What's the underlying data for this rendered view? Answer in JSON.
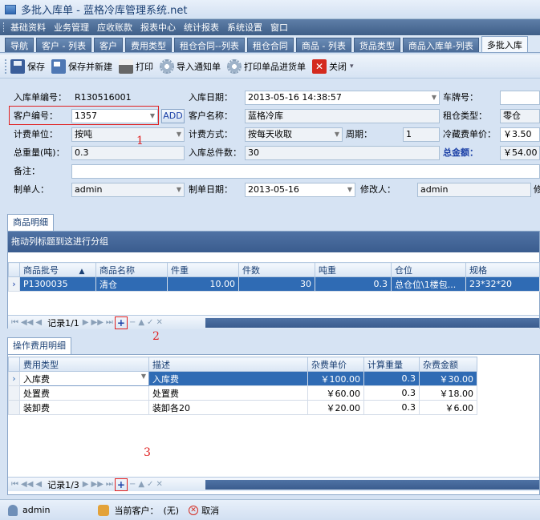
{
  "window": {
    "title": "多批入库单 - 蓝格冷库管理系统.net"
  },
  "menu": [
    "基础资料",
    "业务管理",
    "应收账款",
    "报表中心",
    "统计报表",
    "系统设置",
    "窗口"
  ],
  "tabs": [
    "导航",
    "客户 - 列表",
    "客户",
    "费用类型",
    "租仓合同--列表",
    "租仓合同",
    "商品 - 列表",
    "货品类型",
    "商品入库单-列表",
    "多批入库"
  ],
  "toolbar": {
    "save": "保存",
    "save_new": "保存并新建",
    "print": "打印",
    "import_notice": "导入通知单",
    "print_receipt": "打印单品进货单",
    "close": "关闭"
  },
  "form": {
    "receipt_no_label": "入库单编号：",
    "receipt_no": "R130516001",
    "receipt_date_label": "入库日期：",
    "receipt_date": "2013-05-16  14:38:57",
    "plate_label": "车牌号：",
    "plate": "",
    "customer_no_label": "客户编号：",
    "customer_no": "1357",
    "add_label": "ADD",
    "customer_name_label": "客户名称：",
    "customer_name": "蓝格冷库",
    "rent_type_label": "租仓类型：",
    "rent_type": "零仓",
    "unit_label": "计费单位：",
    "unit": "按吨",
    "method_label": "计费方式：",
    "method": "按每天收取",
    "period_label": "周期：",
    "period": "1",
    "cold_price_label": "冷藏费单价：",
    "cold_price": "￥3.50",
    "total_weight_label": "总重量(吨)：",
    "total_weight": "0.3",
    "total_pieces_label": "入库总件数：",
    "total_pieces": "30",
    "total_amount_label": "总金额：",
    "total_amount": "￥54.00",
    "remark_label": "备注：",
    "remark": "",
    "maker_label": "制单人：",
    "maker": "admin",
    "make_date_label": "制单日期：",
    "make_date": "2013-05-16",
    "modifier_label": "修改人：",
    "modifier": "admin",
    "modify_cut_label": "修"
  },
  "annotations": [
    "1",
    "2",
    "3"
  ],
  "goods": {
    "tab": "商品明细",
    "group_hint": "拖动列标题到这进行分组",
    "columns": [
      "商品批号",
      "▲",
      "商品名称",
      "件重",
      "件数",
      "吨重",
      "仓位",
      "规格"
    ],
    "rows": [
      {
        "batch": "P1300035",
        "name": "清仓",
        "piece_weight": "10.00",
        "pieces": "30",
        "tons": "0.3",
        "location": "总仓位\\1楼包...",
        "spec": "23*32*20"
      }
    ],
    "record": "记录1/1"
  },
  "fees": {
    "tab": "操作费用明细",
    "columns": [
      "费用类型",
      "描述",
      "杂费单价",
      "计算重量",
      "杂费金额"
    ],
    "rows": [
      {
        "type": "入库费",
        "desc": "入库费",
        "price": "￥100.00",
        "weight": "0.3",
        "amount": "￥30.00"
      },
      {
        "type": "处置费",
        "desc": "处置费",
        "price": "￥60.00",
        "weight": "0.3",
        "amount": "￥18.00"
      },
      {
        "type": "装卸费",
        "desc": "装卸各20",
        "price": "￥20.00",
        "weight": "0.3",
        "amount": "￥6.00"
      }
    ],
    "record": "记录1/3"
  },
  "navbar": {
    "first": "⏮",
    "prev_page": "◀◀",
    "prev": "◀",
    "next": "▶",
    "next_page": "▶▶",
    "last": "⏭",
    "add": "+",
    "delete": "−",
    "up": "▲",
    "confirm": "✓",
    "cancel": "✕"
  },
  "status": {
    "user": "admin",
    "current_customer_label": "当前客户：",
    "current_customer": "(无)",
    "cancel": "取消"
  }
}
